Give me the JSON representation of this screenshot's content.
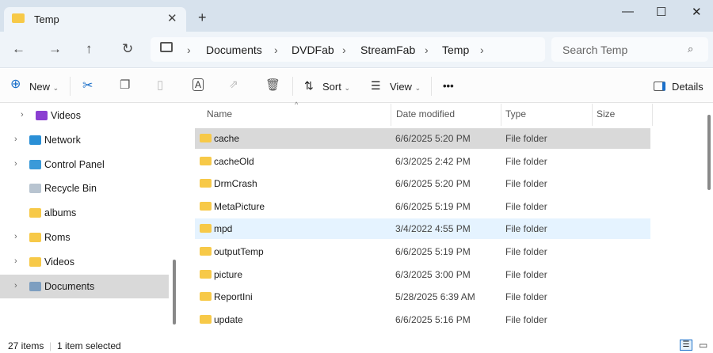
{
  "window": {
    "tab_title": "Temp",
    "close_tab": "✕",
    "new_tab": "+",
    "minimize": "—",
    "maximize": "☐",
    "close": "✕"
  },
  "nav": {
    "back": "←",
    "forward": "→",
    "up": "↑",
    "refresh": "↻"
  },
  "breadcrumb": [
    "Documents",
    "DVDFab",
    "StreamFab",
    "Temp"
  ],
  "search": {
    "placeholder": "Search Temp"
  },
  "toolbar": {
    "new_label": "New",
    "sort_label": "Sort",
    "view_label": "View",
    "more": "•••",
    "details_label": "Details"
  },
  "sidebar": {
    "items": [
      {
        "label": "Videos",
        "icon": "videos-library-icon",
        "color": "#8a3fd1",
        "chev": true,
        "indent": true
      },
      {
        "label": "Network",
        "icon": "network-icon",
        "color": "#2a8fd6",
        "chev": true
      },
      {
        "label": "Control Panel",
        "icon": "control-panel-icon",
        "color": "#3a9ad9",
        "chev": true
      },
      {
        "label": "Recycle Bin",
        "icon": "recycle-bin-icon",
        "color": "#b8c4d0",
        "chev": false
      },
      {
        "label": "albums",
        "icon": "folder-icon",
        "color": "#f7c948",
        "chev": false
      },
      {
        "label": "Roms",
        "icon": "folder-icon",
        "color": "#f7c948",
        "chev": true
      },
      {
        "label": "Videos",
        "icon": "folder-icon",
        "color": "#f7c948",
        "chev": true
      },
      {
        "label": "Documents",
        "icon": "documents-icon",
        "color": "#7d9ec0",
        "chev": true,
        "selected": true
      }
    ]
  },
  "columns": [
    "Name",
    "Date modified",
    "Type",
    "Size"
  ],
  "files": [
    {
      "name": "cache",
      "date": "6/6/2025 5:20 PM",
      "type": "File folder",
      "state": "selected"
    },
    {
      "name": "cacheOld",
      "date": "6/3/2025 2:42 PM",
      "type": "File folder"
    },
    {
      "name": "DrmCrash",
      "date": "6/6/2025 5:20 PM",
      "type": "File folder"
    },
    {
      "name": "MetaPicture",
      "date": "6/6/2025 5:19 PM",
      "type": "File folder"
    },
    {
      "name": "mpd",
      "date": "3/4/2022 4:55 PM",
      "type": "File folder",
      "state": "hover"
    },
    {
      "name": "outputTemp",
      "date": "6/6/2025 5:19 PM",
      "type": "File folder"
    },
    {
      "name": "picture",
      "date": "6/3/2025 3:00 PM",
      "type": "File folder"
    },
    {
      "name": "ReportIni",
      "date": "5/28/2025 6:39 AM",
      "type": "File folder"
    },
    {
      "name": "update",
      "date": "6/6/2025 5:16 PM",
      "type": "File folder"
    }
  ],
  "status": {
    "count": "27 items",
    "selected": "1 item selected"
  }
}
